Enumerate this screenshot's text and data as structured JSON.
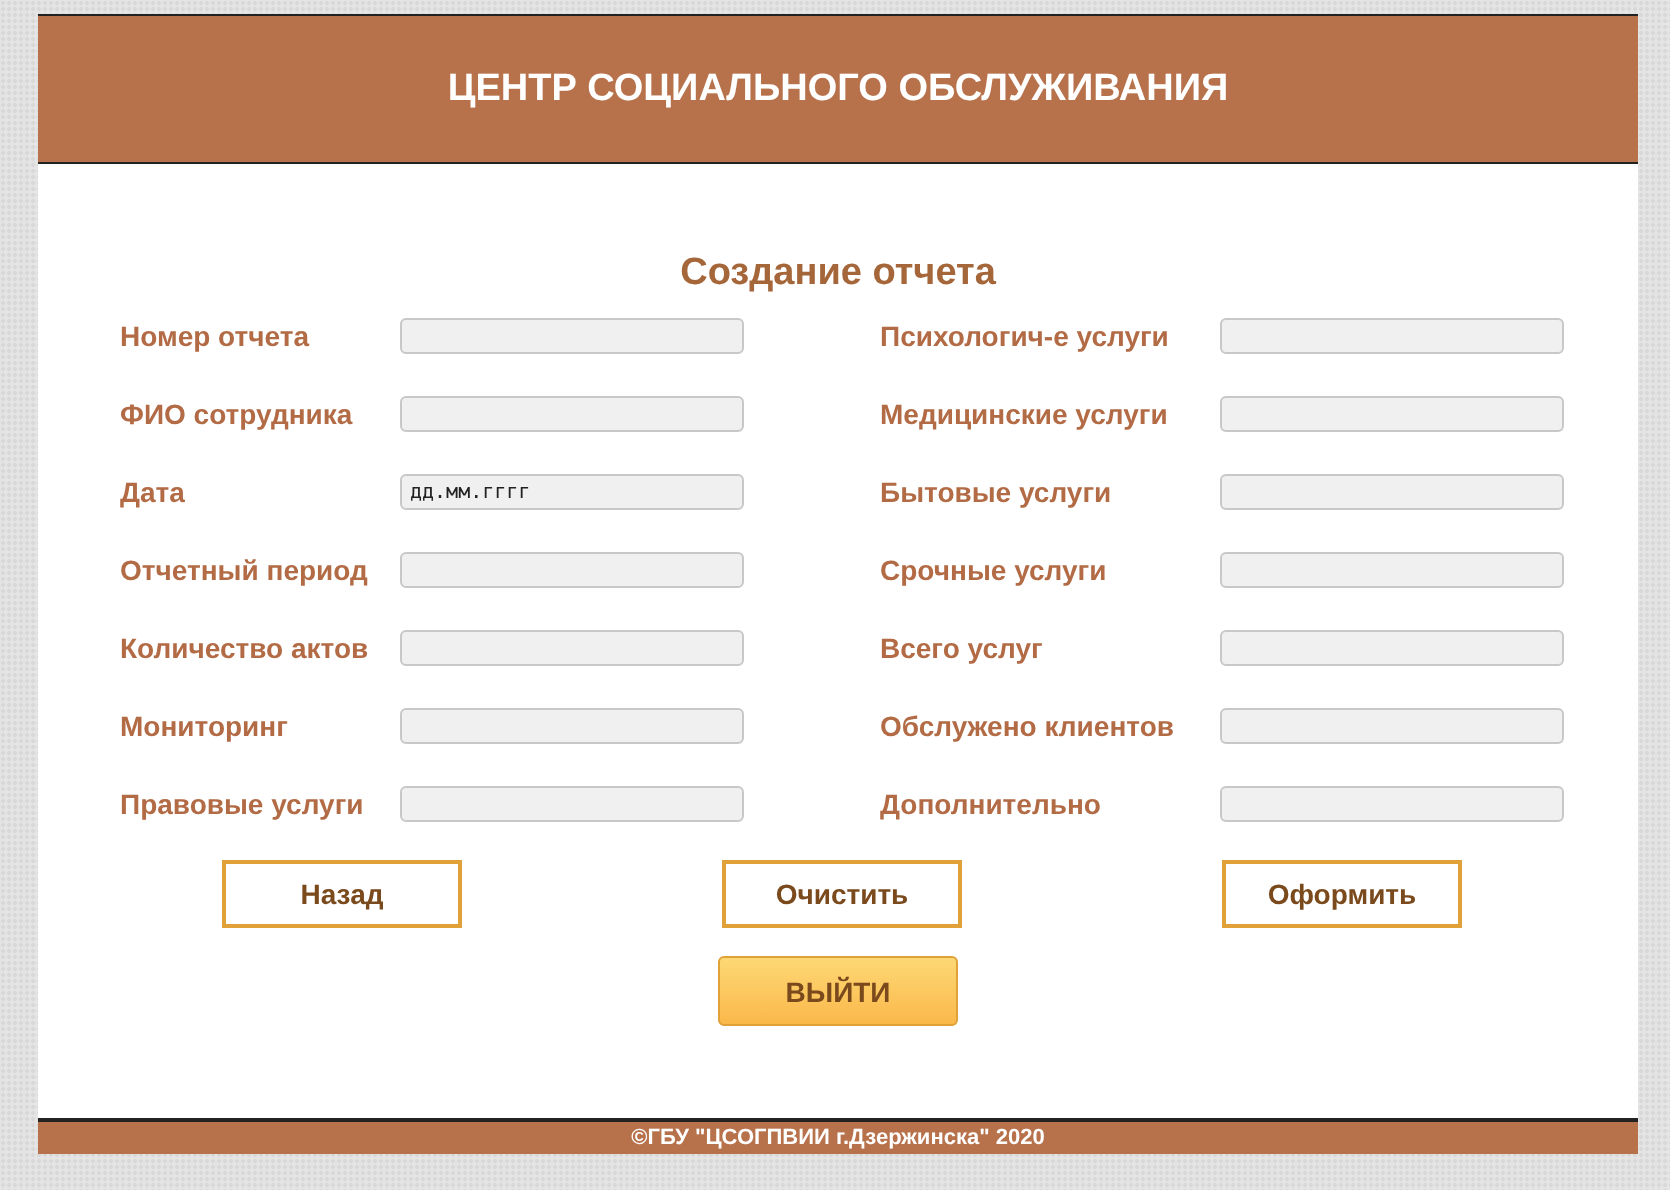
{
  "header": {
    "title": "ЦЕНТР СОЦИАЛЬНОГО ОБСЛУЖИВАНИЯ"
  },
  "form": {
    "title": "Создание отчета",
    "left_fields": [
      {
        "label": "Номер отчета"
      },
      {
        "label": "ФИО сотрудника"
      },
      {
        "label": "Дата",
        "placeholder": "дд.мм.гггг"
      },
      {
        "label": "Отчетный период"
      },
      {
        "label": "Количество актов"
      },
      {
        "label": "Мониторинг"
      },
      {
        "label": "Правовые услуги"
      }
    ],
    "right_fields": [
      {
        "label": "Психологич-е услуги"
      },
      {
        "label": "Медицинские услуги"
      },
      {
        "label": "Бытовые услуги"
      },
      {
        "label": "Срочные услуги"
      },
      {
        "label": "Всего услуг"
      },
      {
        "label": "Обслужено клиентов"
      },
      {
        "label": "Дополнительно"
      }
    ],
    "buttons": [
      "Назад",
      "Очистить",
      "Оформить"
    ],
    "exit_button": "ВЫЙТИ"
  },
  "footer": {
    "text": "©ГБУ \"ЦСОГПВИИ г.Дзержинска\" 2020"
  }
}
